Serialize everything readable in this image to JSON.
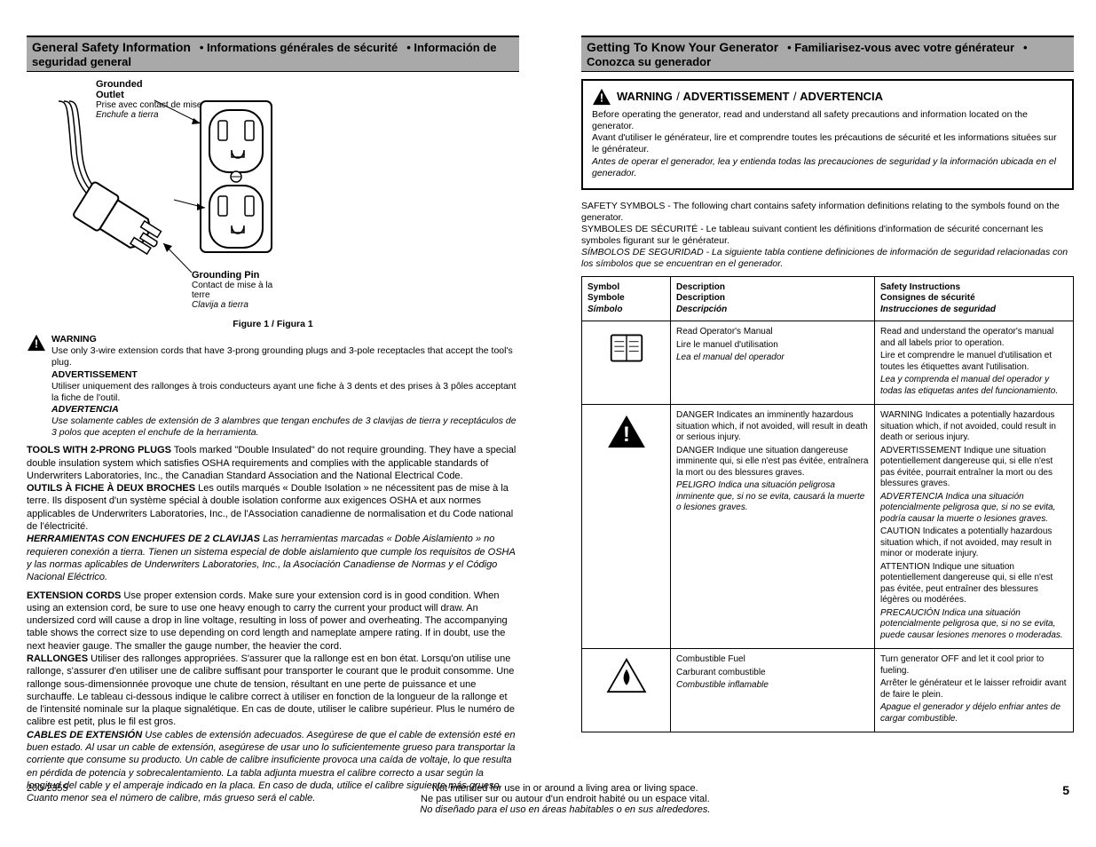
{
  "left": {
    "header": {
      "en": "General Safety Information",
      "fr": "• Informations générales de sécurité",
      "es": "• Información de seguridad general"
    },
    "figure": {
      "outlet": {
        "en": "Grounded Outlet",
        "fr": "Prise avec contact de mise à la terre",
        "es": "Enchufe a tierra"
      },
      "pin": {
        "en": "Grounding Pin",
        "fr": "Contact de mise à la terre",
        "es": "Clavija a tierra"
      }
    },
    "figlabel": {
      "en": "Figure 1 / Figura 1",
      "fr": ""
    },
    "warn_inline": {
      "w1_en": "WARNING",
      "w1_en2": " Use only 3-wire extension cords that have 3-prong grounding plugs and 3-pole receptacles that accept the tool's plug.",
      "w1_fr": "ADVERTISSEMENT",
      "w1_fr2": " Utiliser uniquement des rallonges à trois conducteurs ayant une fiche à 3 dents et des prises à 3 pôles acceptant la fiche de l'outil.",
      "w1_es": "ADVERTENCIA",
      "w1_es2": " Use solamente cables de extensión de 3 alambres que tengan enchufes de 3 clavijas de tierra y receptáculos de 3 polos que acepten el enchufe de la herramienta."
    },
    "cord_para": {
      "en_head": "TOOLS WITH 2-PRONG PLUGS",
      "en_body": " Tools marked \"Double Insulated\" do not require grounding. They have a special double insulation system which satisfies OSHA requirements and complies with the applicable standards of Underwriters Laboratories, Inc., the Canadian Standard Association and the National Electrical Code.",
      "fr_head": "OUTILS À FICHE À DEUX BROCHES",
      "fr_body": " Les outils marqués « Double Isolation » ne nécessitent pas de mise à la terre. Ils disposent d'un système spécial à double isolation conforme aux exigences OSHA et aux normes applicables de Underwriters Laboratories, Inc., de l'Association canadienne de normalisation et du Code national de l'électricité.",
      "es_head": "HERRAMIENTAS CON ENCHUFES DE 2 CLAVIJAS",
      "es_body": " Las herramientas marcadas « Doble Aislamiento » no requieren conexión a tierra. Tienen un sistema especial de doble aislamiento que cumple los requisitos de OSHA y las normas aplicables de Underwriters Laboratories, Inc., la Asociación Canadiense de Normas y el Código Nacional Eléctrico."
    },
    "ext_para": {
      "en_head": "EXTENSION CORDS",
      "en_body": " Use proper extension cords. Make sure your extension cord is in good condition. When using an extension cord, be sure to use one heavy enough to carry the current your product will draw. An undersized cord will cause a drop in line voltage, resulting in loss of power and overheating. The accompanying table shows the correct size to use depending on cord length and nameplate ampere rating. If in doubt, use the next heavier gauge. The smaller the gauge number, the heavier the cord.",
      "fr_head": "RALLONGES",
      "fr_body": " Utiliser des rallonges appropriées. S'assurer que la rallonge est en bon état. Lorsqu'on utilise une rallonge, s'assurer d'en utiliser une de calibre suffisant pour transporter le courant que le produit consomme. Une rallonge sous-dimensionnée provoque une chute de tension, résultant en une perte de puissance et une surchauffe. Le tableau ci-dessous indique le calibre correct à utiliser en fonction de la longueur de la rallonge et de l'intensité nominale sur la plaque signalétique. En cas de doute, utiliser le calibre supérieur. Plus le numéro de calibre est petit, plus le fil est gros.",
      "es_head": "CABLES DE EXTENSIÓN",
      "es_body": " Use cables de extensión adecuados. Asegúrese de que el cable de extensión esté en buen estado. Al usar un cable de extensión, asegúrese de usar uno lo suficientemente grueso para transportar la corriente que consume su producto. Un cable de calibre insuficiente provoca una caída de voltaje, lo que resulta en pérdida de potencia y sobrecalentamiento. La tabla adjunta muestra el calibre correcto a usar según la longitud del cable y el amperaje indicado en la placa. En caso de duda, utilice el calibre siguiente más grueso. Cuanto menor sea el número de calibre, más grueso será el cable."
    }
  },
  "right": {
    "header": {
      "en": "Getting To Know Your Generator",
      "fr": "• Familiarisez-vous avec votre générateur",
      "es": "• Conozca su generador"
    },
    "warning": {
      "label_en": "WARNING",
      "label_fr": "ADVERTISSEMENT",
      "label_es": "ADVERTENCIA",
      "body_en": "Before operating the generator, read and understand all safety precautions and information located on the generator.",
      "body_fr": "Avant d'utiliser le générateur, lire et comprendre toutes les précautions de sécurité et les informations situées sur le générateur.",
      "body_es": "Antes de operar el generador, lea y entienda todas las precauciones de seguridad y la información ubicada en el generador."
    },
    "tbl_intro": {
      "en": "SAFETY SYMBOLS - The following chart contains safety information definitions relating to the symbols found on the generator.",
      "fr": "SYMBOLES DE SÉCURITÉ - Le tableau suivant contient les définitions d'information de sécurité concernant les symboles figurant sur le générateur.",
      "es": "SÍMBOLOS DE SEGURIDAD - La siguiente tabla contiene definiciones de información de seguridad relacionadas con los símbolos que se encuentran en el generador."
    },
    "table": {
      "head": {
        "c1_en": "Symbol",
        "c1_fr": "Symbole",
        "c1_es": "Símbolo",
        "c2_en": "Description",
        "c2_fr": "Description",
        "c2_es": "Descripción",
        "c3_en": "Safety Instructions",
        "c3_fr": "Consignes de sécurité",
        "c3_es": "Instrucciones de seguridad"
      },
      "rows": [
        {
          "sym": "manual",
          "desc_en": "Read Operator's Manual",
          "desc_fr": "Lire le manuel d'utilisation",
          "desc_es": "Lea el manual del operador",
          "inst_en": "Read and understand the operator's manual and all labels prior to operation.",
          "inst_fr": "Lire et comprendre le manuel d'utilisation et toutes les étiquettes avant l'utilisation.",
          "inst_es": "Lea y comprenda el manual del operador y todas las etiquetas antes del funcionamiento."
        },
        {
          "sym": "danger",
          "desc_en": "DANGER Indicates an imminently hazardous situation which, if not avoided, will result in death or serious injury.",
          "desc_fr": "DANGER Indique une situation dangereuse imminente qui, si elle n'est pas évitée, entraînera la mort ou des blessures graves.",
          "desc_es": "PELIGRO Indica una situación peligrosa inminente que, si no se evita, causará la muerte o lesiones graves.",
          "inst_en": "WARNING Indicates a potentially hazardous situation which, if not avoided, could result in death or serious injury.",
          "inst_fr": "ADVERTISSEMENT Indique une situation potentiellement dangereuse qui, si elle n'est pas évitée, pourrait entraîner la mort ou des blessures graves.",
          "inst_es": "ADVERTENCIA Indica una situación potencialmente peligrosa que, si no se evita, podría causar la muerte o lesiones graves.",
          "inst2_en": "CAUTION Indicates a potentially hazardous situation which, if not avoided, may result in minor or moderate injury.",
          "inst2_fr": "ATTENTION Indique une situation potentiellement dangereuse qui, si elle n'est pas évitée, peut entraîner des blessures légères ou modérées.",
          "inst2_es": "PRECAUCIÓN Indica una situación potencialmente peligrosa que, si no se evita, puede causar lesiones menores o moderadas."
        },
        {
          "sym": "fuel",
          "desc_en": "Combustible Fuel",
          "desc_fr": "Carburant combustible",
          "desc_es": "Combustible inflamable",
          "inst_en": "Turn generator OFF and let it cool prior to fueling.",
          "inst_fr": "Arrêter le générateur et le laisser refroidir avant de faire le plein.",
          "inst_es": "Apague el generador y déjelo enfriar antes de cargar combustible."
        }
      ]
    }
  },
  "footer": {
    "left": "200-2355",
    "center_en": "Not intended for use in or around a living area or living space.",
    "center_fr": "Ne pas utiliser sur ou autour d'un endroit habité ou un espace vital.",
    "center_es": "No diseñado para el uso en áreas habitables o en sus alrededores.",
    "page": "5"
  }
}
